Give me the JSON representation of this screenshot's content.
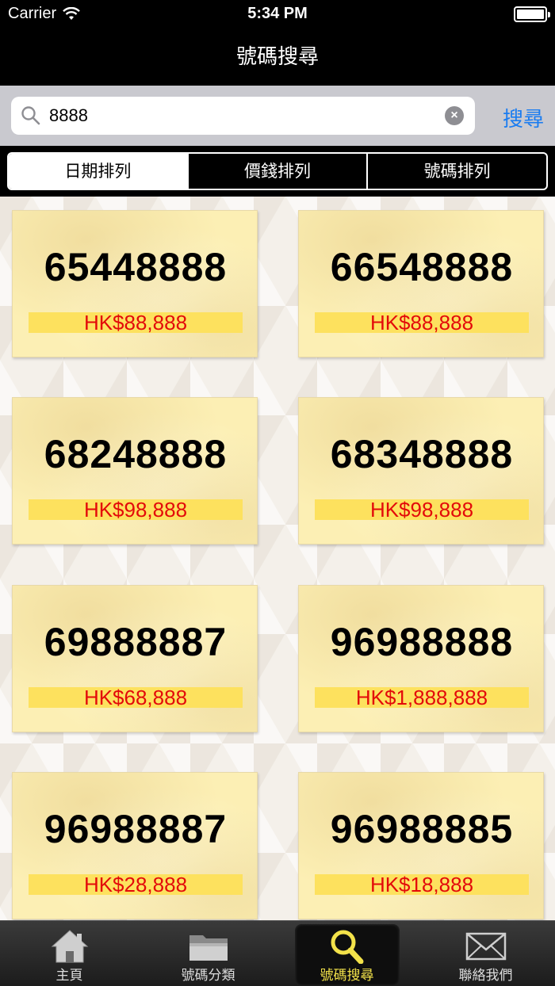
{
  "status_bar": {
    "carrier": "Carrier",
    "time": "5:34 PM"
  },
  "nav": {
    "title": "號碼搜尋"
  },
  "search": {
    "value": "8888",
    "button_label": "搜尋"
  },
  "segments": [
    {
      "label": "日期排列",
      "active": true
    },
    {
      "label": "價錢排列",
      "active": false
    },
    {
      "label": "號碼排列",
      "active": false
    }
  ],
  "listings": [
    {
      "number": "65448888",
      "price": "HK$88,888"
    },
    {
      "number": "66548888",
      "price": "HK$88,888"
    },
    {
      "number": "68248888",
      "price": "HK$98,888"
    },
    {
      "number": "68348888",
      "price": "HK$98,888"
    },
    {
      "number": "69888887",
      "price": "HK$68,888"
    },
    {
      "number": "96988888",
      "price": "HK$1,888,888"
    },
    {
      "number": "96988887",
      "price": "HK$28,888"
    },
    {
      "number": "96988885",
      "price": "HK$18,888"
    }
  ],
  "tabs": [
    {
      "label": "主頁",
      "icon": "home-icon",
      "active": false
    },
    {
      "label": "號碼分類",
      "icon": "folder-icon",
      "active": false
    },
    {
      "label": "號碼搜尋",
      "icon": "search-icon",
      "active": true
    },
    {
      "label": "聯絡我們",
      "icon": "mail-icon",
      "active": false
    }
  ],
  "colors": {
    "accent": "#1a7cf0",
    "price": "#e30a0a",
    "active_tab": "#f3e24a",
    "card": "#fcefb4"
  }
}
